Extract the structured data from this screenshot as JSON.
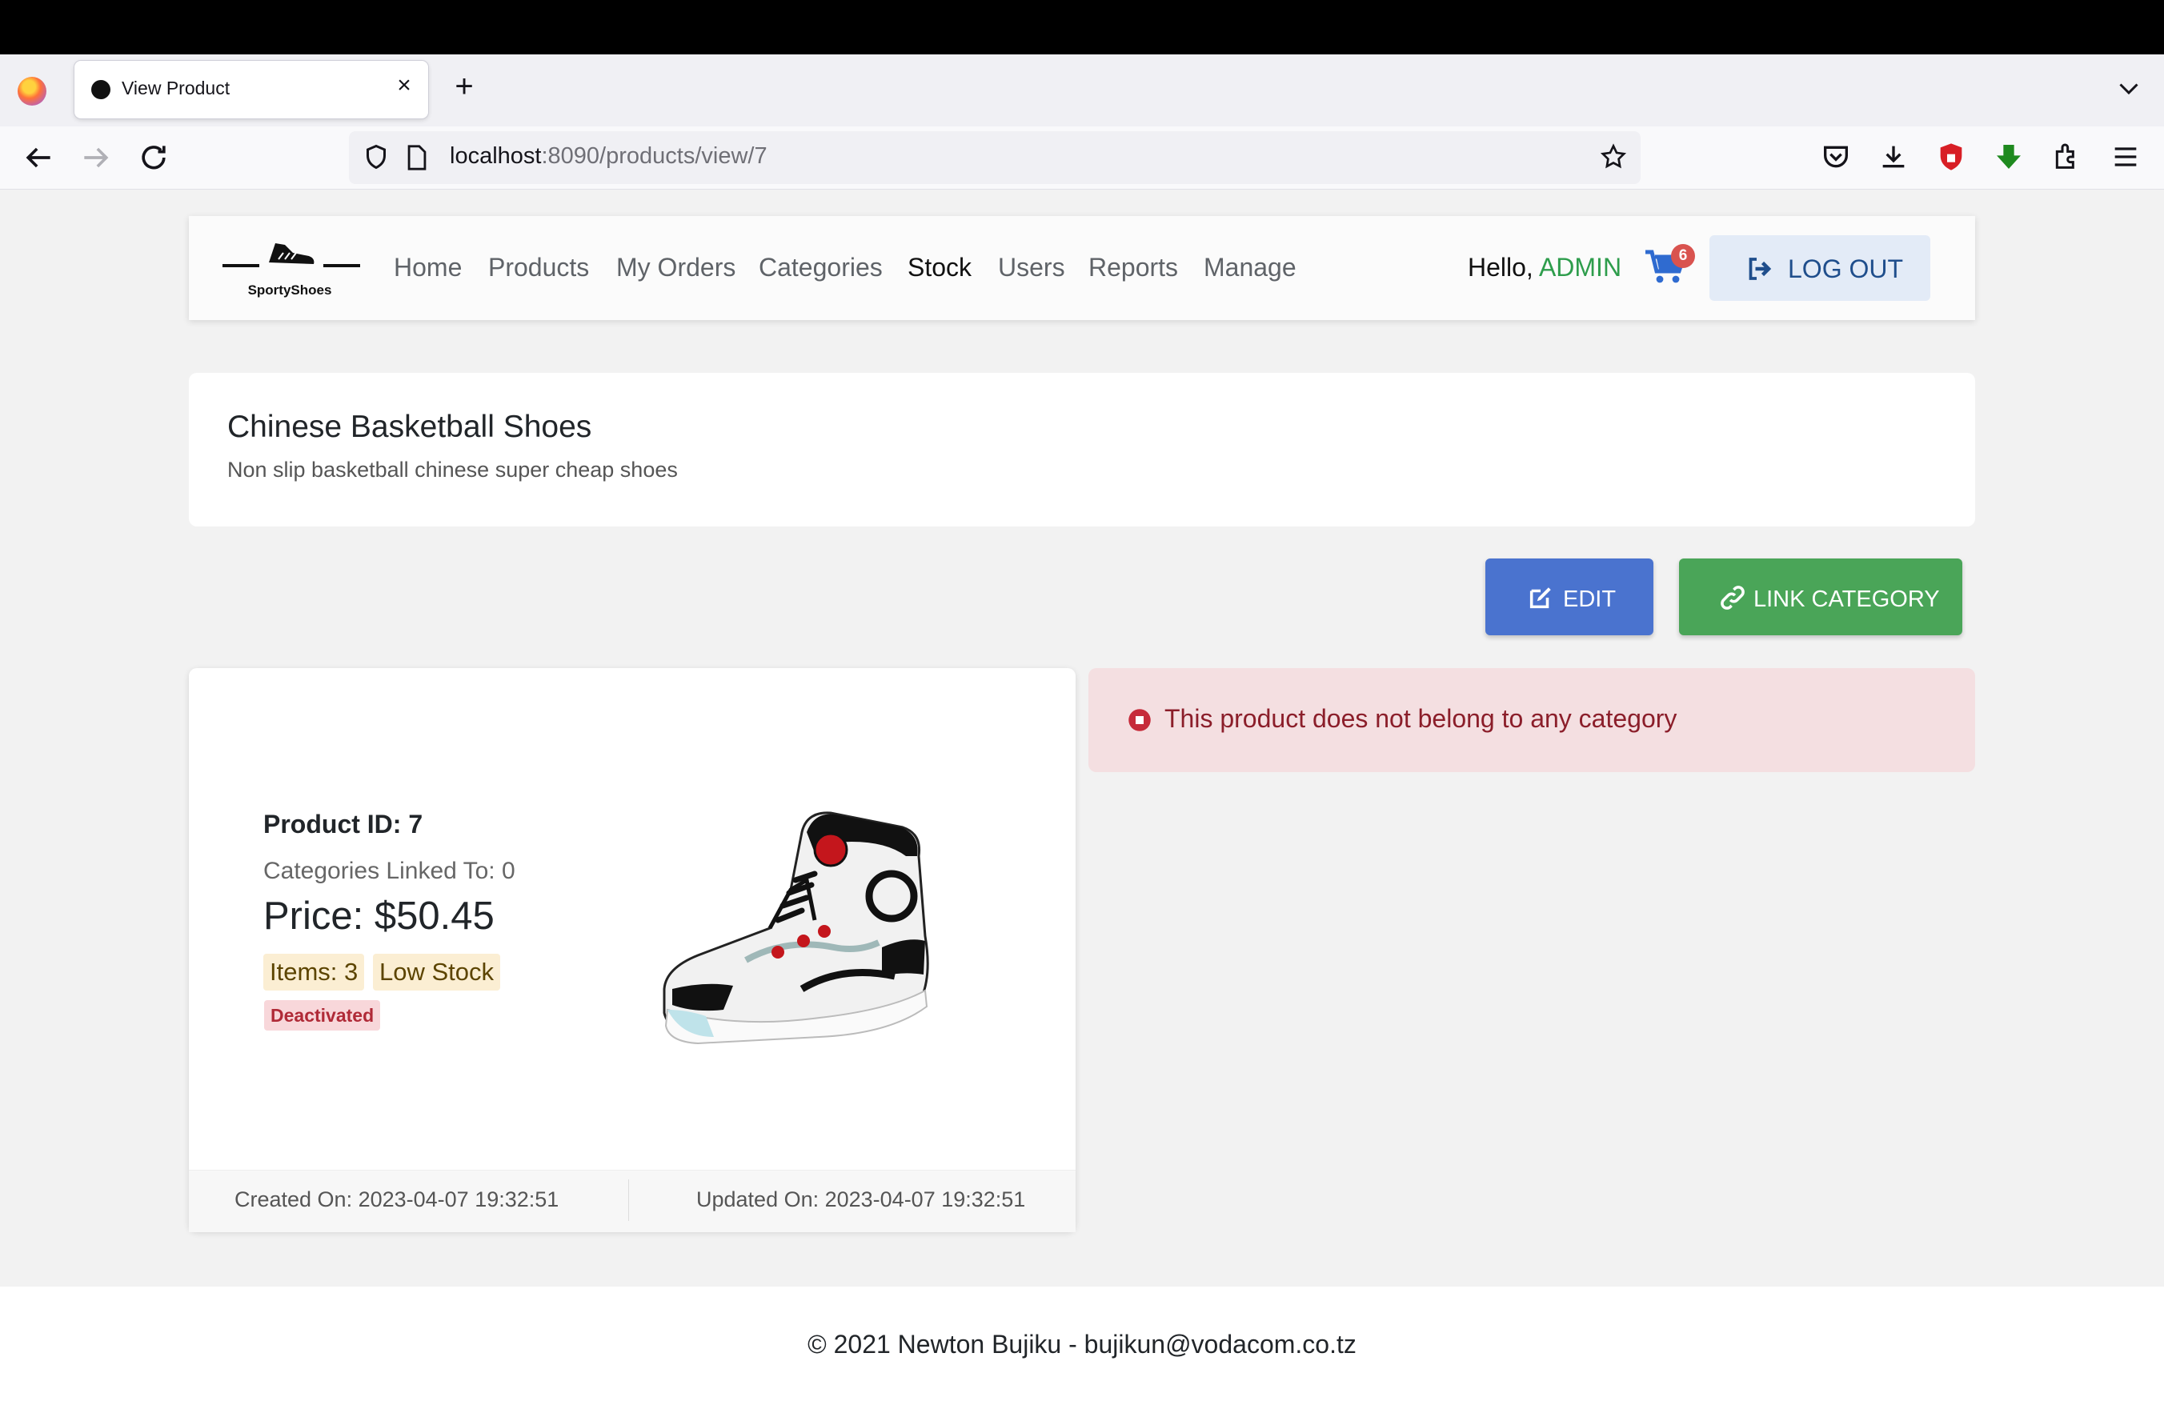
{
  "browser": {
    "tab_title": "View Product",
    "url_host": "localhost",
    "url_rest": ":8090/products/view/7"
  },
  "app": {
    "logo_text": "SportyShoes",
    "nav": [
      "Home",
      "Products",
      "My Orders",
      "Categories",
      "Stock",
      "Users",
      "Reports",
      "Manage"
    ],
    "active_nav": "Stock",
    "greeting": "Hello,",
    "username": "ADMIN",
    "cart_count": "6",
    "logout_label": "LOG OUT"
  },
  "product": {
    "name": "Chinese Basketball Shoes",
    "description": "Non slip basketball chinese super cheap shoes",
    "id_label": "Product ID: 7",
    "categories_label": "Categories Linked To: 0",
    "price_label": "Price: $50.45",
    "items_badge": "Items: 3",
    "stock_badge": "Low Stock",
    "status_badge": "Deactivated",
    "created": "Created On: 2023-04-07 19:32:51",
    "updated": "Updated On: 2023-04-07 19:32:51"
  },
  "actions": {
    "edit_label": "EDIT",
    "link_category_label": "LINK CATEGORY"
  },
  "alert": {
    "message": "This product does not belong to any category"
  },
  "footer": {
    "copyright": "© 2021 Newton Bujiku - bujikun@vodacom.co.tz"
  },
  "colors": {
    "edit_button": "#4a73cf",
    "link_button": "#4aa558",
    "admin_text": "#2e9d4c",
    "alert_bg": "#f4dfe1"
  }
}
